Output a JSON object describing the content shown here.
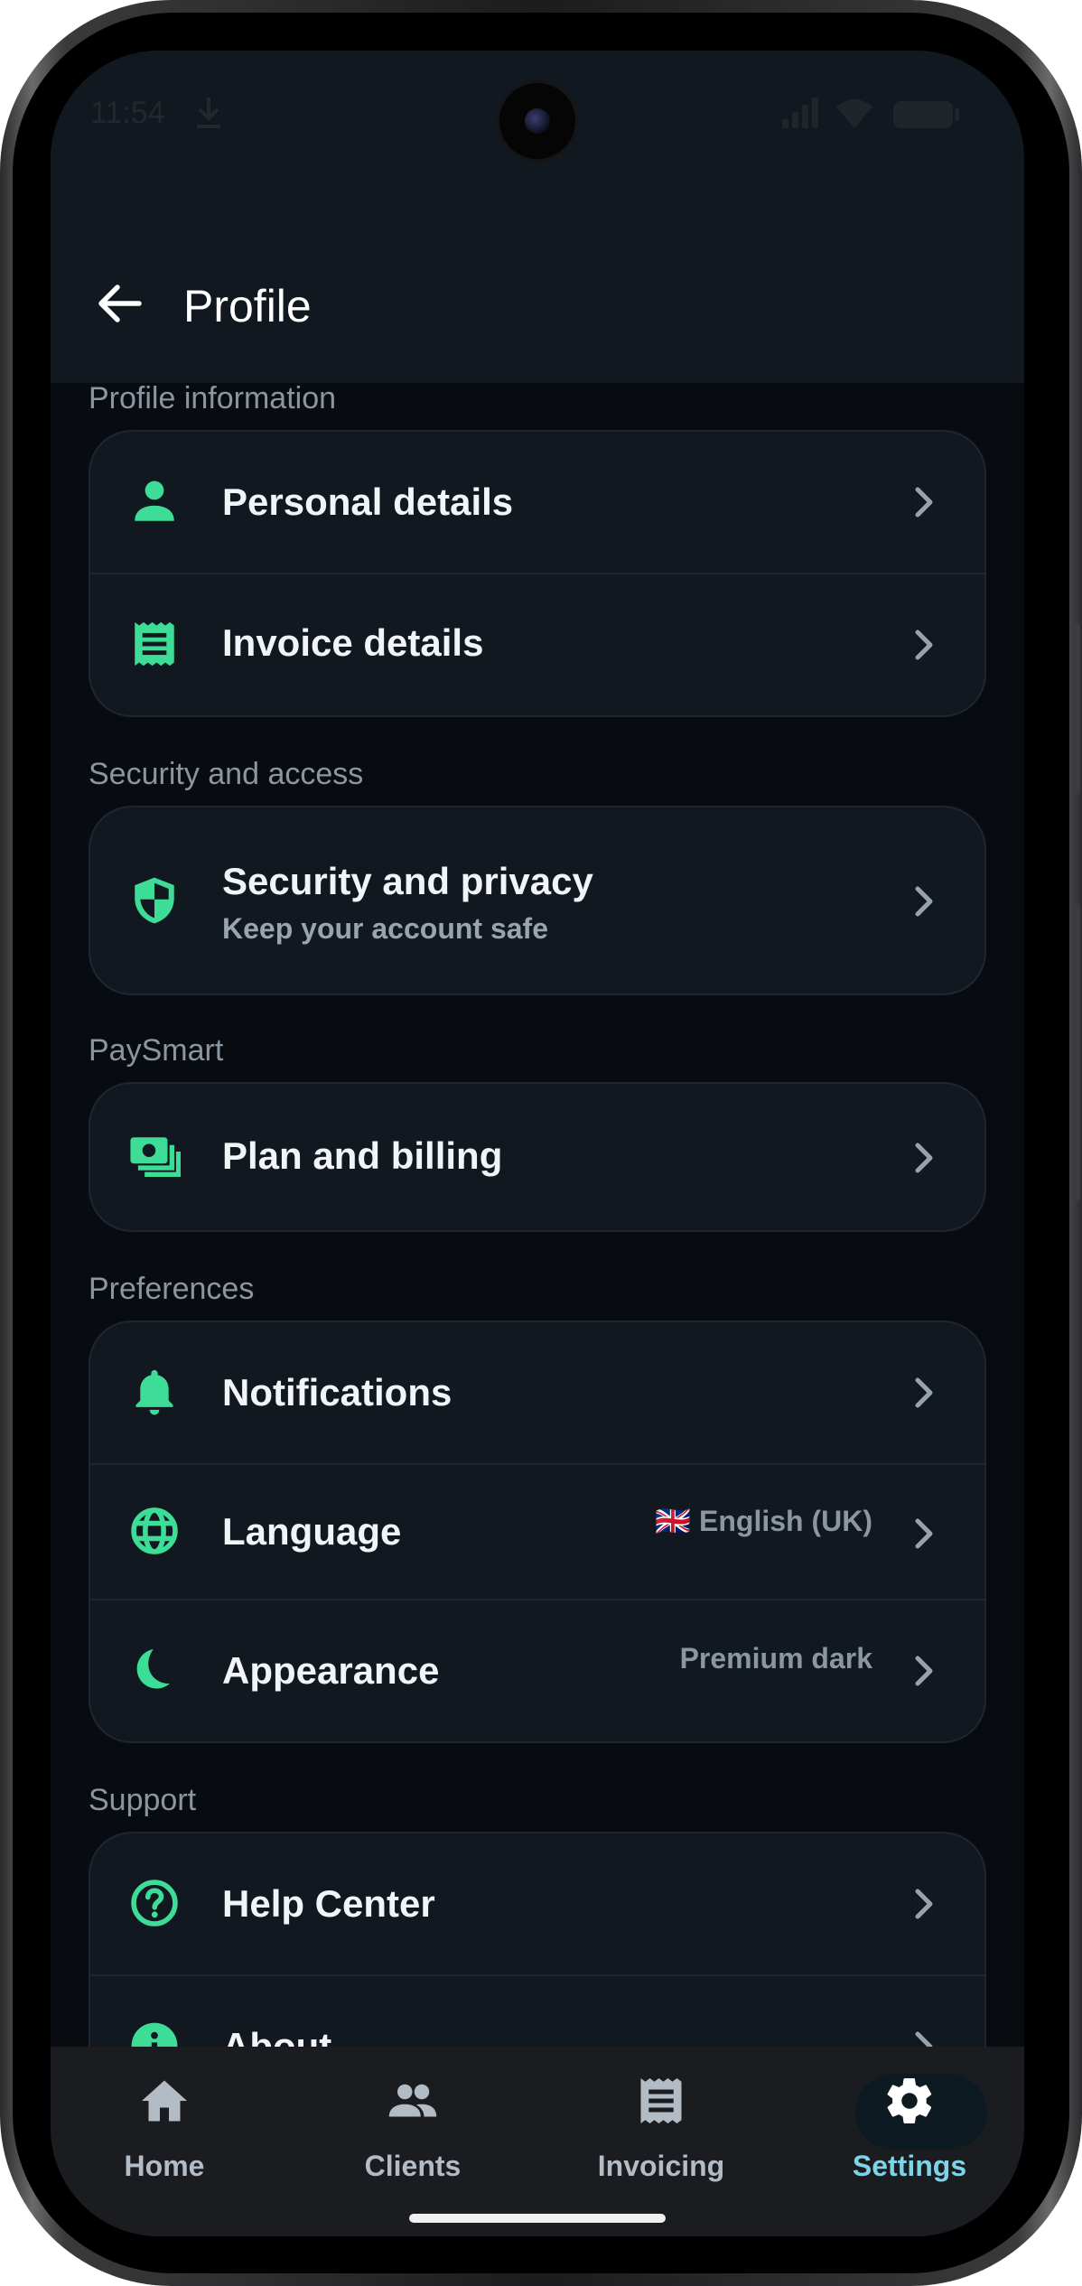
{
  "status_bar": {
    "time": "11:54"
  },
  "header": {
    "title": "Profile"
  },
  "sections": {
    "profile_information": {
      "label": "Profile information",
      "items": [
        {
          "label": "Personal details",
          "icon": "person-icon"
        },
        {
          "label": "Invoice details",
          "icon": "receipt-icon"
        }
      ]
    },
    "security_access": {
      "label": "Security and access",
      "items": [
        {
          "label": "Security and privacy",
          "subtitle": "Keep your account safe",
          "icon": "shield-icon"
        }
      ]
    },
    "paysmart": {
      "label": "PaySmart",
      "items": [
        {
          "label": "Plan and billing",
          "icon": "payments-icon"
        }
      ]
    },
    "preferences": {
      "label": "Preferences",
      "items": [
        {
          "label": "Notifications",
          "icon": "bell-icon"
        },
        {
          "label": "Language",
          "value": "🇬🇧 English (UK)",
          "icon": "globe-icon"
        },
        {
          "label": "Appearance",
          "value": "Premium dark",
          "icon": "moon-icon"
        }
      ]
    },
    "support": {
      "label": "Support",
      "items": [
        {
          "label": "Help Center",
          "icon": "help-circle-icon"
        },
        {
          "label": "About",
          "icon": "info-icon"
        }
      ]
    }
  },
  "bottom_nav": {
    "items": [
      {
        "label": "Home",
        "icon": "home-icon"
      },
      {
        "label": "Clients",
        "icon": "people-icon"
      },
      {
        "label": "Invoicing",
        "icon": "invoice-icon"
      },
      {
        "label": "Settings",
        "icon": "gear-icon",
        "active": true
      }
    ]
  },
  "colors": {
    "accent": "#3ddc97",
    "active_nav": "#7dd3e8",
    "background": "#080c10",
    "card": "#111820"
  }
}
